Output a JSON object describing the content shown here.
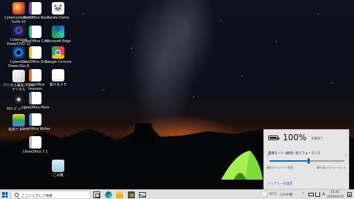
{
  "desktop": {
    "icons": [
      {
        "label": "CyberLink Media Suite 10",
        "icon": "cyberlink-media-suite-icon"
      },
      {
        "label": "CyberLink PowerDVD 12",
        "icon": "powerdvd-icon"
      },
      {
        "label": "CyberLink Power2Go 8",
        "icon": "power2go-icon"
      },
      {
        "label": "デジタル署名さんあデジタル",
        "icon": "pdf-icon"
      },
      {
        "label": "ISO ビューアー",
        "icon": "iso-viewer-icon"
      },
      {
        "label": "仮想ドライブ",
        "icon": "virtual-drive-icon"
      },
      {
        "label": "LibreOffice Base",
        "icon": "libreoffice-base-icon"
      },
      {
        "label": "LibreOffice Calc",
        "icon": "libreoffice-calc-icon"
      },
      {
        "label": "LibreOffice Draw",
        "icon": "libreoffice-draw-icon"
      },
      {
        "label": "LibreOffice Impress",
        "icon": "libreoffice-impress-icon"
      },
      {
        "label": "LibreOffice Math",
        "icon": "libreoffice-math-icon"
      },
      {
        "label": "LibreOffice Writer",
        "icon": "libreoffice-writer-icon"
      },
      {
        "label": "LibreOffice 7.1",
        "icon": "libreoffice-icon"
      },
      {
        "label": "Panda Dome",
        "icon": "panda-dome-icon"
      },
      {
        "label": "Microsoft Edge",
        "icon": "edge-icon"
      },
      {
        "label": "Google Chrome",
        "icon": "chrome-icon"
      },
      {
        "label": "書けるメモ",
        "icon": "memo-icon"
      },
      {
        "label": "ごみ箱",
        "icon": "recycle-bin-icon"
      }
    ]
  },
  "battery_flyout": {
    "percent": "100%",
    "status": "充電完了",
    "mode_label": "電源モード (接続): 高パフォーマンス",
    "left_caption": "最大のバッテリー寿命",
    "right_caption": "最も高いパフォーマンス",
    "mode_level": 0.52,
    "settings_link": "バッテリーの設定"
  },
  "taskbar": {
    "search_placeholder": "ここに入力して検索",
    "temperature": "31°C",
    "weather_text": "にわか雨",
    "time": "15:41",
    "date": "2021/07/15",
    "ime": "A"
  },
  "colors": {
    "accent": "#0067c0",
    "taskbar_bg": "#e6e6e6",
    "flyout_bg": "#eeeeee"
  }
}
